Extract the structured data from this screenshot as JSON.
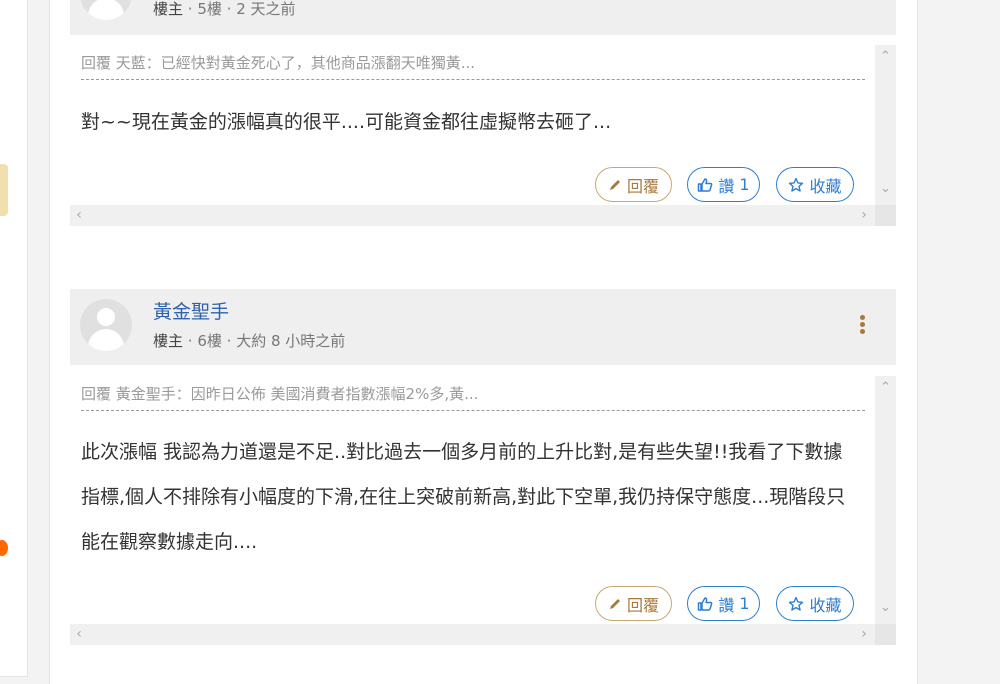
{
  "post5": {
    "meta_role": "樓主",
    "meta_floor": "5樓",
    "meta_time": "2 天之前",
    "quote": "回覆 天藍：已經快對黃金死心了，其他商品漲翻天唯獨黃...",
    "body": "對~~現在黃金的漲幅真的很平....可能資金都往虛擬幣去砸了...",
    "reply_label": "回覆",
    "like_label": "讚",
    "like_count": "1",
    "fav_label": "收藏"
  },
  "post6": {
    "author": "黃金聖手",
    "meta_role": "樓主",
    "meta_floor": "6樓",
    "meta_time": "大約 8 小時之前",
    "quote": "回覆 黃金聖手：因昨日公佈 美國消費者指數漲幅2%多,黃...",
    "body": "此次漲幅 我認為力道還是不足..對比過去一個多月前的上升比對,是有些失望!!我看了下數據指標,個人不排除有小幅度的下滑,在往上突破前新高,對此下空單,我仍持保守態度...現階段只能在觀察數據走向....",
    "reply_label": "回覆",
    "like_label": "讚",
    "like_count": "1",
    "fav_label": "收藏"
  },
  "icons": {
    "reply": "pencil-icon",
    "like": "thumbs-up-icon",
    "fav": "star-icon",
    "more": "more-vertical-icon"
  },
  "colors": {
    "accent_gold": "#a67a3d",
    "accent_blue": "#2f7fd0",
    "author_blue": "#2f62a8"
  }
}
